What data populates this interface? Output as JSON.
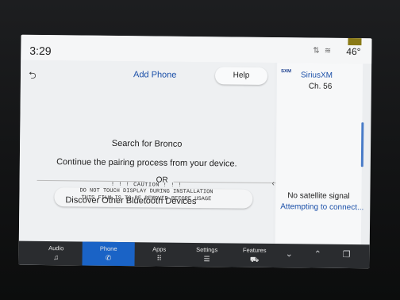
{
  "status": {
    "time": "3:29",
    "temperature": "46°",
    "icons": [
      "signal-arrows-icon",
      "wifi-icon"
    ]
  },
  "main": {
    "title": "Add Phone",
    "help_label": "Help",
    "search_text": "Search for Bronco",
    "pairing_text": "Continue the pairing process from your device.",
    "or_text": "OR",
    "discover_label": "Discover Other Bluetooth Devices"
  },
  "film_notice": {
    "caution": "! ! ! CAUTION ! ! !",
    "line1": "DO NOT TOUCH DISPLAY DURING INSTALLATION",
    "line2": "THIS FILM IS TO BE REMOVED BEFORE USAGE"
  },
  "side_panel": {
    "logo": "SXM",
    "title": "SiriusXM",
    "channel": "Ch. 56",
    "message": "No satellite signal",
    "sub_message": "Attempting to connect..."
  },
  "bottom_nav": {
    "tabs": [
      {
        "label": "Audio",
        "icon": "music-note-icon",
        "glyph": "♫"
      },
      {
        "label": "Phone",
        "icon": "phone-icon",
        "glyph": "✆"
      },
      {
        "label": "Apps",
        "icon": "apps-grid-icon",
        "glyph": "⠿"
      },
      {
        "label": "Settings",
        "icon": "settings-sliders-icon",
        "glyph": "☰"
      },
      {
        "label": "Features",
        "icon": "vehicle-icon",
        "glyph": "⛟"
      }
    ],
    "active_tab": "Phone"
  },
  "colors": {
    "accent": "#1a4fa8",
    "active_tab": "#1a63c6",
    "bar": "#2a2c2f"
  }
}
